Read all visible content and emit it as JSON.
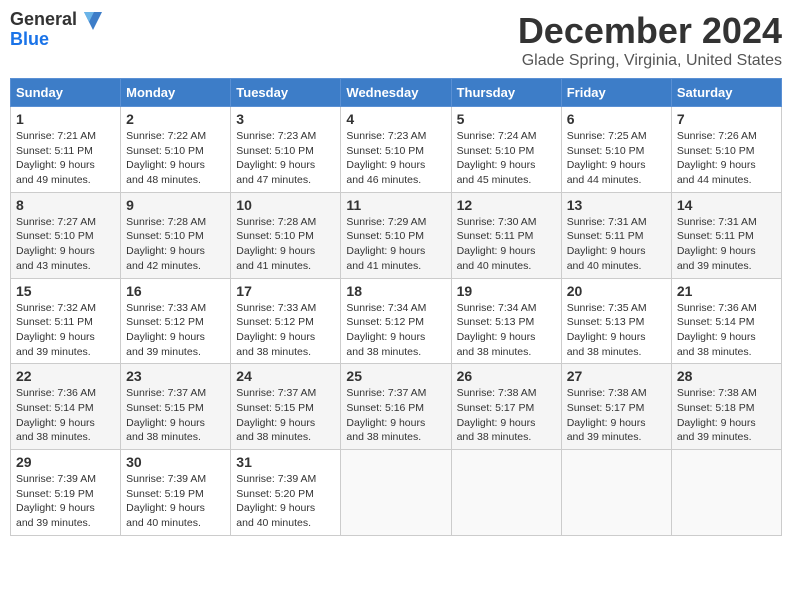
{
  "logo": {
    "general": "General",
    "blue": "Blue"
  },
  "title": "December 2024",
  "subtitle": "Glade Spring, Virginia, United States",
  "weekdays": [
    "Sunday",
    "Monday",
    "Tuesday",
    "Wednesday",
    "Thursday",
    "Friday",
    "Saturday"
  ],
  "weeks": [
    [
      {
        "day": "1",
        "sunrise": "Sunrise: 7:21 AM",
        "sunset": "Sunset: 5:11 PM",
        "daylight": "Daylight: 9 hours and 49 minutes."
      },
      {
        "day": "2",
        "sunrise": "Sunrise: 7:22 AM",
        "sunset": "Sunset: 5:10 PM",
        "daylight": "Daylight: 9 hours and 48 minutes."
      },
      {
        "day": "3",
        "sunrise": "Sunrise: 7:23 AM",
        "sunset": "Sunset: 5:10 PM",
        "daylight": "Daylight: 9 hours and 47 minutes."
      },
      {
        "day": "4",
        "sunrise": "Sunrise: 7:23 AM",
        "sunset": "Sunset: 5:10 PM",
        "daylight": "Daylight: 9 hours and 46 minutes."
      },
      {
        "day": "5",
        "sunrise": "Sunrise: 7:24 AM",
        "sunset": "Sunset: 5:10 PM",
        "daylight": "Daylight: 9 hours and 45 minutes."
      },
      {
        "day": "6",
        "sunrise": "Sunrise: 7:25 AM",
        "sunset": "Sunset: 5:10 PM",
        "daylight": "Daylight: 9 hours and 44 minutes."
      },
      {
        "day": "7",
        "sunrise": "Sunrise: 7:26 AM",
        "sunset": "Sunset: 5:10 PM",
        "daylight": "Daylight: 9 hours and 44 minutes."
      }
    ],
    [
      {
        "day": "8",
        "sunrise": "Sunrise: 7:27 AM",
        "sunset": "Sunset: 5:10 PM",
        "daylight": "Daylight: 9 hours and 43 minutes."
      },
      {
        "day": "9",
        "sunrise": "Sunrise: 7:28 AM",
        "sunset": "Sunset: 5:10 PM",
        "daylight": "Daylight: 9 hours and 42 minutes."
      },
      {
        "day": "10",
        "sunrise": "Sunrise: 7:28 AM",
        "sunset": "Sunset: 5:10 PM",
        "daylight": "Daylight: 9 hours and 41 minutes."
      },
      {
        "day": "11",
        "sunrise": "Sunrise: 7:29 AM",
        "sunset": "Sunset: 5:10 PM",
        "daylight": "Daylight: 9 hours and 41 minutes."
      },
      {
        "day": "12",
        "sunrise": "Sunrise: 7:30 AM",
        "sunset": "Sunset: 5:11 PM",
        "daylight": "Daylight: 9 hours and 40 minutes."
      },
      {
        "day": "13",
        "sunrise": "Sunrise: 7:31 AM",
        "sunset": "Sunset: 5:11 PM",
        "daylight": "Daylight: 9 hours and 40 minutes."
      },
      {
        "day": "14",
        "sunrise": "Sunrise: 7:31 AM",
        "sunset": "Sunset: 5:11 PM",
        "daylight": "Daylight: 9 hours and 39 minutes."
      }
    ],
    [
      {
        "day": "15",
        "sunrise": "Sunrise: 7:32 AM",
        "sunset": "Sunset: 5:11 PM",
        "daylight": "Daylight: 9 hours and 39 minutes."
      },
      {
        "day": "16",
        "sunrise": "Sunrise: 7:33 AM",
        "sunset": "Sunset: 5:12 PM",
        "daylight": "Daylight: 9 hours and 39 minutes."
      },
      {
        "day": "17",
        "sunrise": "Sunrise: 7:33 AM",
        "sunset": "Sunset: 5:12 PM",
        "daylight": "Daylight: 9 hours and 38 minutes."
      },
      {
        "day": "18",
        "sunrise": "Sunrise: 7:34 AM",
        "sunset": "Sunset: 5:12 PM",
        "daylight": "Daylight: 9 hours and 38 minutes."
      },
      {
        "day": "19",
        "sunrise": "Sunrise: 7:34 AM",
        "sunset": "Sunset: 5:13 PM",
        "daylight": "Daylight: 9 hours and 38 minutes."
      },
      {
        "day": "20",
        "sunrise": "Sunrise: 7:35 AM",
        "sunset": "Sunset: 5:13 PM",
        "daylight": "Daylight: 9 hours and 38 minutes."
      },
      {
        "day": "21",
        "sunrise": "Sunrise: 7:36 AM",
        "sunset": "Sunset: 5:14 PM",
        "daylight": "Daylight: 9 hours and 38 minutes."
      }
    ],
    [
      {
        "day": "22",
        "sunrise": "Sunrise: 7:36 AM",
        "sunset": "Sunset: 5:14 PM",
        "daylight": "Daylight: 9 hours and 38 minutes."
      },
      {
        "day": "23",
        "sunrise": "Sunrise: 7:37 AM",
        "sunset": "Sunset: 5:15 PM",
        "daylight": "Daylight: 9 hours and 38 minutes."
      },
      {
        "day": "24",
        "sunrise": "Sunrise: 7:37 AM",
        "sunset": "Sunset: 5:15 PM",
        "daylight": "Daylight: 9 hours and 38 minutes."
      },
      {
        "day": "25",
        "sunrise": "Sunrise: 7:37 AM",
        "sunset": "Sunset: 5:16 PM",
        "daylight": "Daylight: 9 hours and 38 minutes."
      },
      {
        "day": "26",
        "sunrise": "Sunrise: 7:38 AM",
        "sunset": "Sunset: 5:17 PM",
        "daylight": "Daylight: 9 hours and 38 minutes."
      },
      {
        "day": "27",
        "sunrise": "Sunrise: 7:38 AM",
        "sunset": "Sunset: 5:17 PM",
        "daylight": "Daylight: 9 hours and 39 minutes."
      },
      {
        "day": "28",
        "sunrise": "Sunrise: 7:38 AM",
        "sunset": "Sunset: 5:18 PM",
        "daylight": "Daylight: 9 hours and 39 minutes."
      }
    ],
    [
      {
        "day": "29",
        "sunrise": "Sunrise: 7:39 AM",
        "sunset": "Sunset: 5:19 PM",
        "daylight": "Daylight: 9 hours and 39 minutes."
      },
      {
        "day": "30",
        "sunrise": "Sunrise: 7:39 AM",
        "sunset": "Sunset: 5:19 PM",
        "daylight": "Daylight: 9 hours and 40 minutes."
      },
      {
        "day": "31",
        "sunrise": "Sunrise: 7:39 AM",
        "sunset": "Sunset: 5:20 PM",
        "daylight": "Daylight: 9 hours and 40 minutes."
      },
      null,
      null,
      null,
      null
    ]
  ]
}
